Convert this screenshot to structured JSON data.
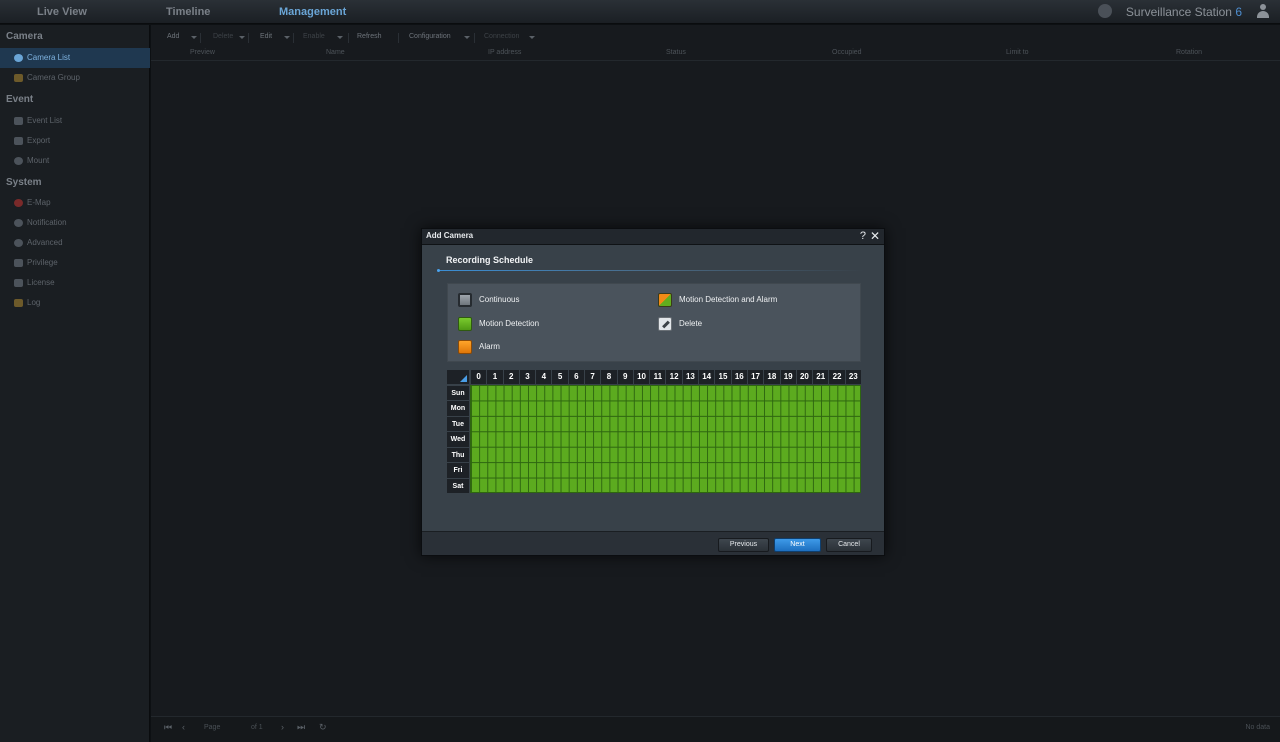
{
  "topbar": {
    "tabs": [
      "Live View",
      "Timeline",
      "Management"
    ],
    "brand": "Surveillance Station",
    "brand_version": "6"
  },
  "sidebar": {
    "sections": [
      {
        "title": "Camera",
        "items": [
          {
            "label": "Camera List",
            "active": true,
            "icon": "camera-icon"
          },
          {
            "label": "Camera Group",
            "icon": "folder-icon"
          }
        ]
      },
      {
        "title": "Event",
        "items": [
          {
            "label": "Event List",
            "icon": "list-icon"
          },
          {
            "label": "Export",
            "icon": "export-icon"
          },
          {
            "label": "Mount",
            "icon": "mount-icon"
          }
        ]
      },
      {
        "title": "System",
        "items": [
          {
            "label": "E-Map",
            "icon": "map-icon"
          },
          {
            "label": "Notification",
            "icon": "notification-icon"
          },
          {
            "label": "Advanced",
            "icon": "gear-icon"
          },
          {
            "label": "Privilege",
            "icon": "lock-icon"
          },
          {
            "label": "License",
            "icon": "key-icon"
          },
          {
            "label": "Log",
            "icon": "log-icon"
          }
        ]
      }
    ]
  },
  "toolbar": {
    "buttons": [
      {
        "label": "Add",
        "dim": false
      },
      {
        "label": "Delete",
        "dim": true
      },
      {
        "label": "Edit",
        "dim": false
      },
      {
        "label": "Enable",
        "dim": true
      },
      {
        "label": "Refresh",
        "dim": false
      },
      {
        "label": "Configuration",
        "dim": false
      },
      {
        "label": "Connection",
        "dim": true
      }
    ]
  },
  "table": {
    "headers": [
      "Preview",
      "Name",
      "IP address",
      "Status",
      "Occupied",
      "Limit to",
      "Rotation"
    ]
  },
  "pager": {
    "page_label": "Page",
    "of_label": "of 1",
    "status": "No data"
  },
  "dialog": {
    "title": "Add Camera",
    "step_title": "Recording Schedule",
    "legend": [
      {
        "label": "Continuous",
        "swatch": "cont"
      },
      {
        "label": "Motion Detection and Alarm",
        "swatch": "ma"
      },
      {
        "label": "Motion Detection",
        "swatch": "motion"
      },
      {
        "label": "Delete",
        "swatch": "del"
      },
      {
        "label": "Alarm",
        "swatch": "alarm"
      }
    ],
    "schedule": {
      "hours": [
        "0",
        "1",
        "2",
        "3",
        "4",
        "5",
        "6",
        "7",
        "8",
        "9",
        "10",
        "11",
        "12",
        "13",
        "14",
        "15",
        "16",
        "17",
        "18",
        "19",
        "20",
        "21",
        "22",
        "23"
      ],
      "days": [
        "Sun",
        "Mon",
        "Tue",
        "Wed",
        "Thu",
        "Fri",
        "Sat"
      ],
      "all_slots": "Motion Detection"
    },
    "buttons": {
      "previous": "Previous",
      "next": "Next",
      "cancel": "Cancel"
    }
  },
  "colors": {
    "accent": "#3b8fd6",
    "motion": "#5cab1f",
    "alarm": "#f28a16",
    "continuous": "#8c939a"
  }
}
